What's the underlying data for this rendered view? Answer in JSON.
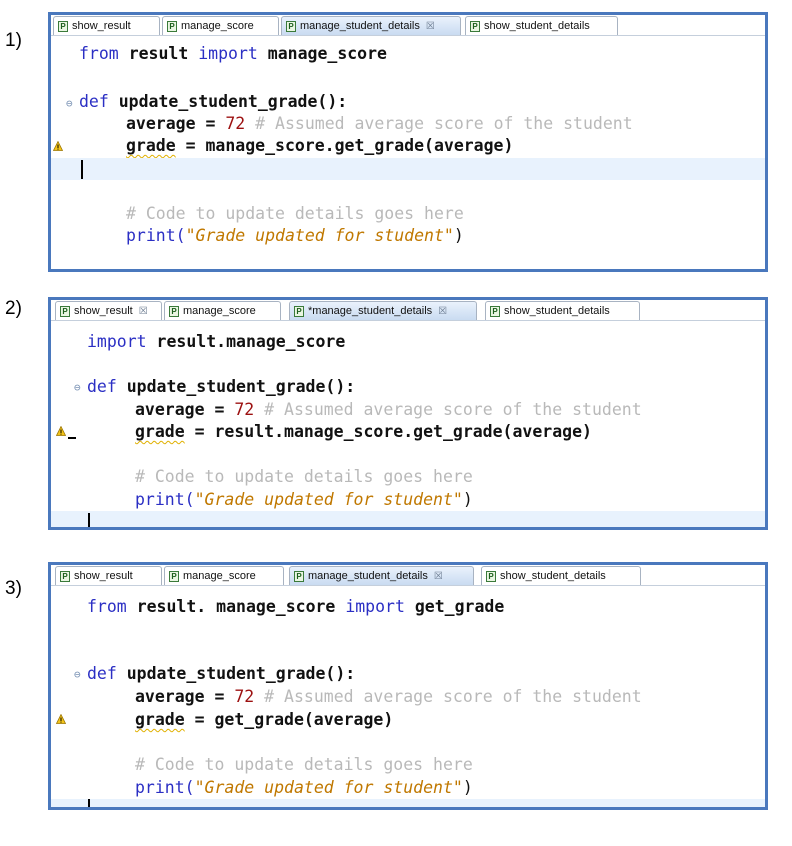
{
  "panels": [
    {
      "number": "1)",
      "tabs": [
        {
          "label": "show_result",
          "icon": "P",
          "close": ""
        },
        {
          "label": "manage_score",
          "icon": "P",
          "close": ""
        },
        {
          "label": "manage_student_details",
          "icon": "P",
          "close": "☒"
        },
        {
          "label": "show_student_details",
          "icon": "P",
          "close": ""
        }
      ],
      "line_import": {
        "kw1": "from",
        "mod": "result",
        "kw2": "import",
        "name": "manage_score"
      },
      "def": {
        "kw": "def",
        "name": "update_student_grade():"
      },
      "average": {
        "lhs": "average = ",
        "num": "72",
        "comment": "# Assumed average score of the student"
      },
      "grade": {
        "lhs": "grade",
        "rhs": " = manage_score.get_grade(average)"
      },
      "comment": "# Code to update details goes here",
      "print": {
        "fn": "print(",
        "str": "\"Grade updated for student\"",
        "end": ")"
      }
    },
    {
      "number": "2)",
      "tabs": [
        {
          "label": "show_result",
          "icon": "P",
          "close": "☒"
        },
        {
          "label": "manage_score",
          "icon": "P",
          "close": ""
        },
        {
          "label": "*manage_student_details",
          "icon": "P",
          "close": "☒"
        },
        {
          "label": "show_student_details",
          "icon": "P",
          "close": ""
        }
      ],
      "line_import": {
        "kw1": "import",
        "mod": "result.manage_score"
      },
      "def": {
        "kw": "def",
        "name": "update_student_grade():"
      },
      "average": {
        "lhs": "average = ",
        "num": "72",
        "comment": "# Assumed average score of the student"
      },
      "grade": {
        "lhs": "grade",
        "rhs": " = result.manage_score.get_grade(average)"
      },
      "comment": "# Code to update details goes here",
      "print": {
        "fn": "print(",
        "str": "\"Grade updated for student\"",
        "end": ")"
      }
    },
    {
      "number": "3)",
      "tabs": [
        {
          "label": "show_result",
          "icon": "P",
          "close": ""
        },
        {
          "label": "manage_score",
          "icon": "P",
          "close": ""
        },
        {
          "label": "manage_student_details",
          "icon": "P",
          "close": "☒"
        },
        {
          "label": "show_student_details",
          "icon": "P",
          "close": ""
        }
      ],
      "line_import": {
        "kw1": "from",
        "mod": "result. manage_score",
        "kw2": "import",
        "name": "get_grade"
      },
      "def": {
        "kw": "def",
        "name": "update_student_grade():"
      },
      "average": {
        "lhs": "average = ",
        "num": "72",
        "comment": "# Assumed average score of the student"
      },
      "grade": {
        "lhs": "grade",
        "rhs": " = get_grade(average)"
      },
      "comment": "# Code to update details goes here",
      "print": {
        "fn": "print(",
        "str": "\"Grade updated for student\"",
        "end": ")"
      }
    }
  ],
  "icons": {
    "fold": "fold-collapse-icon",
    "warning": "warning-icon",
    "file": "python-file-icon"
  },
  "colors": {
    "border": "#4a78bd",
    "keyword": "#2b2fc4",
    "number": "#9c1010",
    "comment": "#b9b9b9",
    "string": "#c07800",
    "current_line": "#e8f2fd"
  }
}
